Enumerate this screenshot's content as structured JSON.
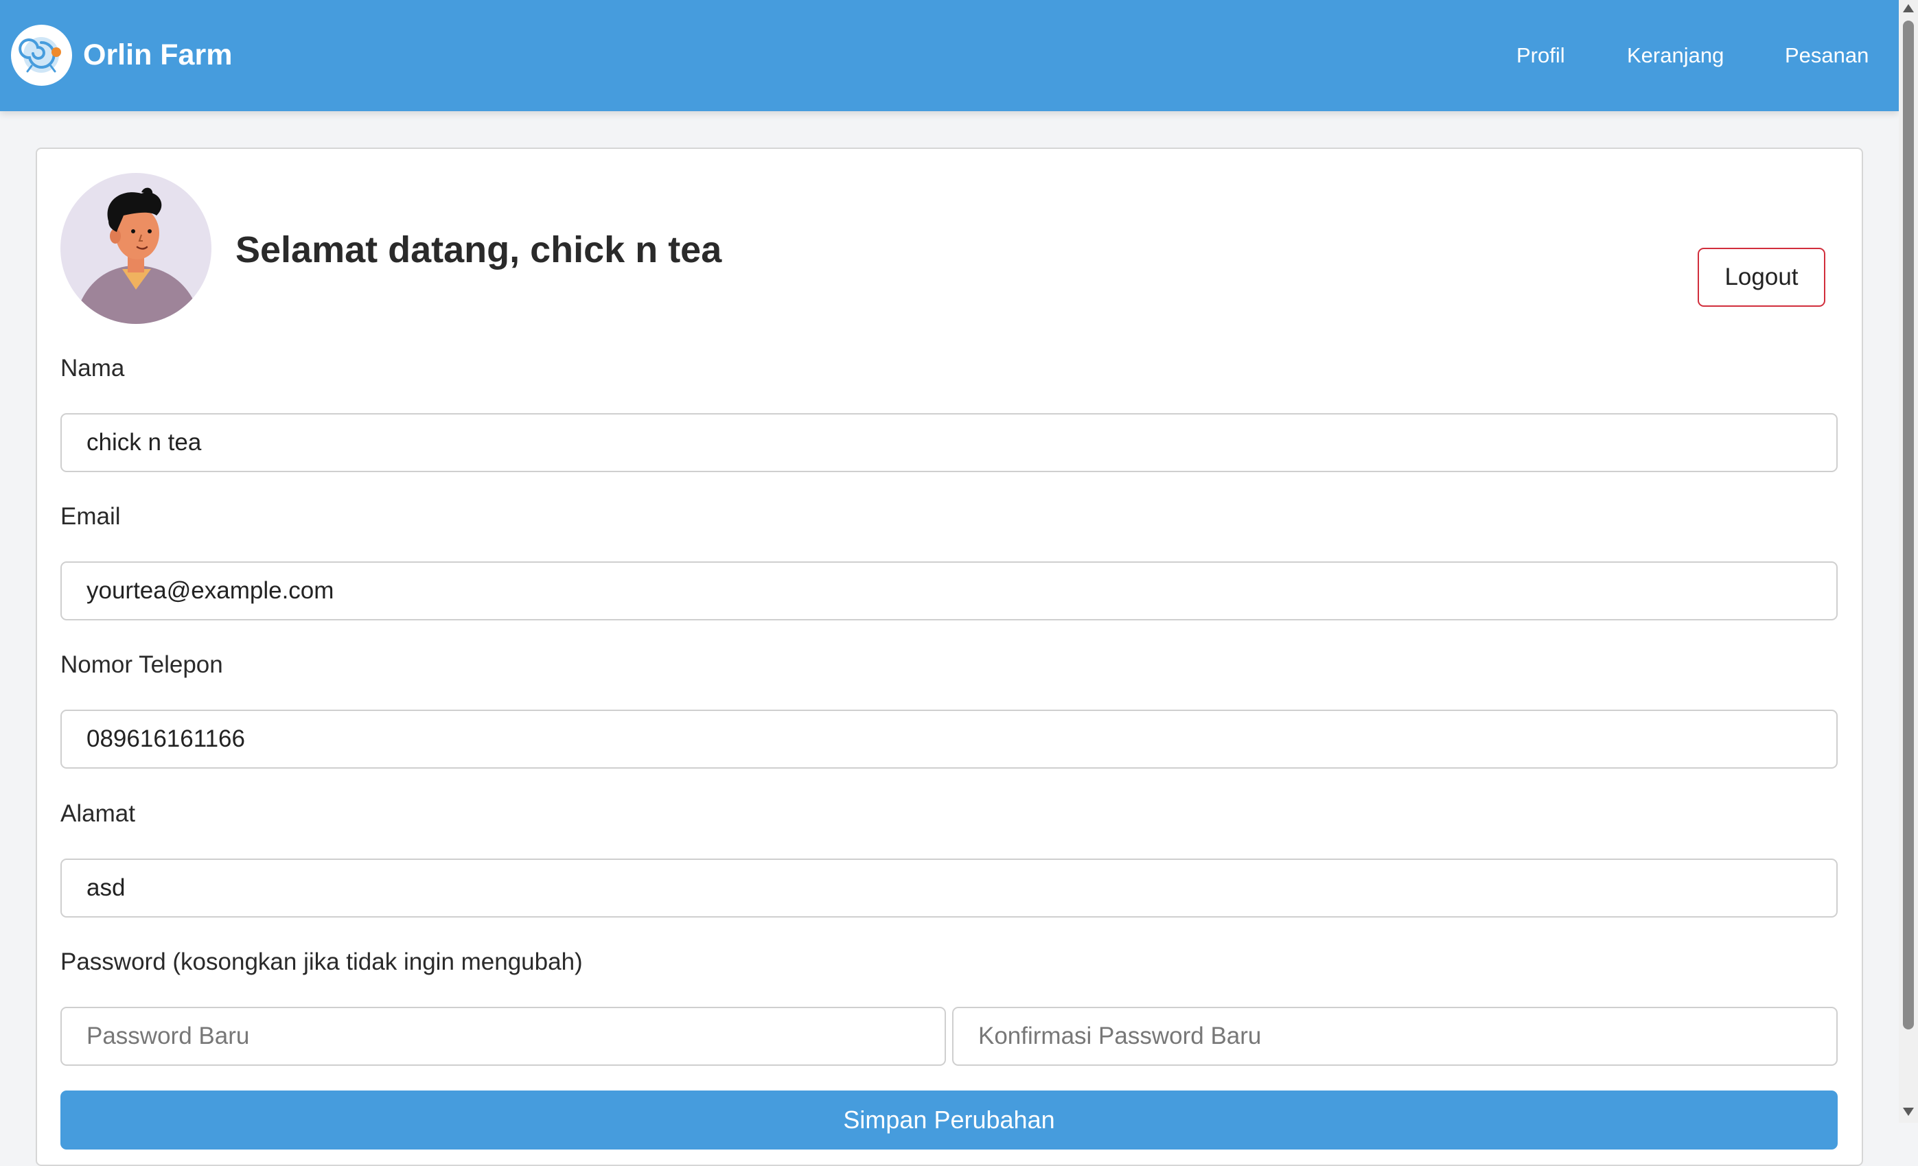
{
  "header": {
    "brand": "Orlin Farm",
    "logo_icon": "orlin-farm-logo-icon",
    "nav": [
      {
        "label": "Profil"
      },
      {
        "label": "Keranjang"
      },
      {
        "label": "Pesanan"
      }
    ],
    "color": "#469cdd"
  },
  "profile": {
    "welcome": "Selamat datang, chick n tea",
    "avatar_icon": "user-avatar-illustration",
    "logout_label": "Logout"
  },
  "form": {
    "name_label": "Nama",
    "name_value": "chick n tea",
    "email_label": "Email",
    "email_value": "yourtea@example.com",
    "phone_label": "Nomor Telepon",
    "phone_value": "089616161166",
    "address_label": "Alamat",
    "address_value": "asd",
    "password_label": "Password (kosongkan jika tidak ingin mengubah)",
    "new_password_placeholder": "Password Baru",
    "confirm_password_placeholder": "Konfirmasi Password Baru",
    "submit_label": "Simpan Perubahan"
  },
  "colors": {
    "accent": "#469cdd",
    "danger": "#d12e3c"
  }
}
